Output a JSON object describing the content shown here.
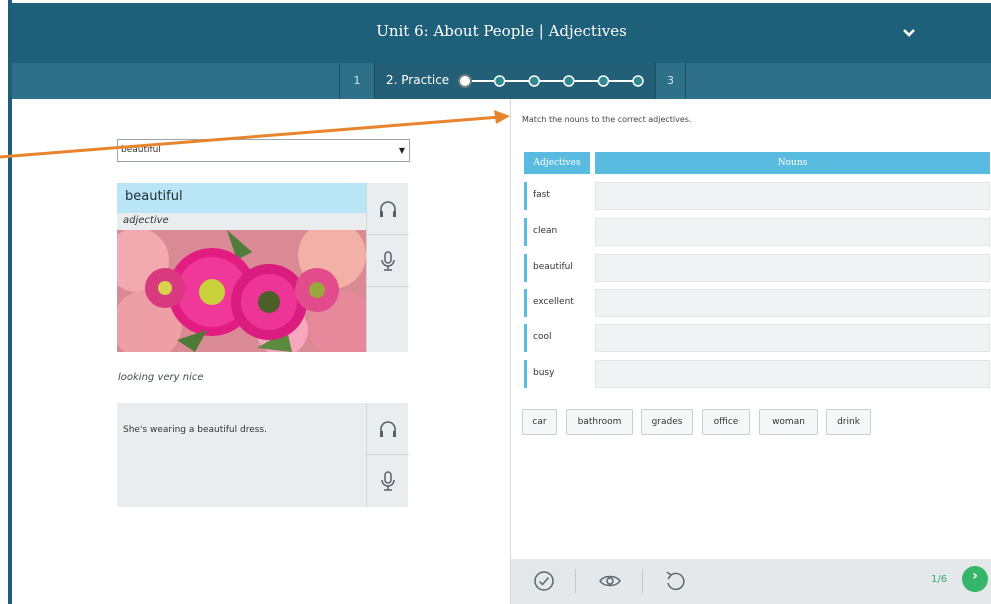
{
  "header": {
    "title": "Unit 6: About People | Adjectives"
  },
  "steps": {
    "step1": "1",
    "step2": "2. Practice",
    "step3": "3",
    "progress_dots_filled": 1,
    "progress_dots_total": 6
  },
  "left": {
    "select_value": "beautiful",
    "word": "beautiful",
    "part_of_speech": "adjective",
    "definition": "looking very nice",
    "example": "She's wearing a beautiful dress."
  },
  "right": {
    "instruction": "Match the nouns to the correct adjectives.",
    "col_adjectives": "Adjectives",
    "col_nouns": "Nouns",
    "adjectives": [
      "fast",
      "clean",
      "beautiful",
      "excellent",
      "cool",
      "busy"
    ],
    "nouns": [
      "car",
      "bathroom",
      "grades",
      "office",
      "woman",
      "drink"
    ]
  },
  "footer": {
    "counter": "1/6",
    "next_glyph": "›"
  },
  "colors": {
    "header": "#1e607a",
    "accent": "#58bbdf",
    "next": "#36b56b",
    "pointer": "#e8842e"
  }
}
